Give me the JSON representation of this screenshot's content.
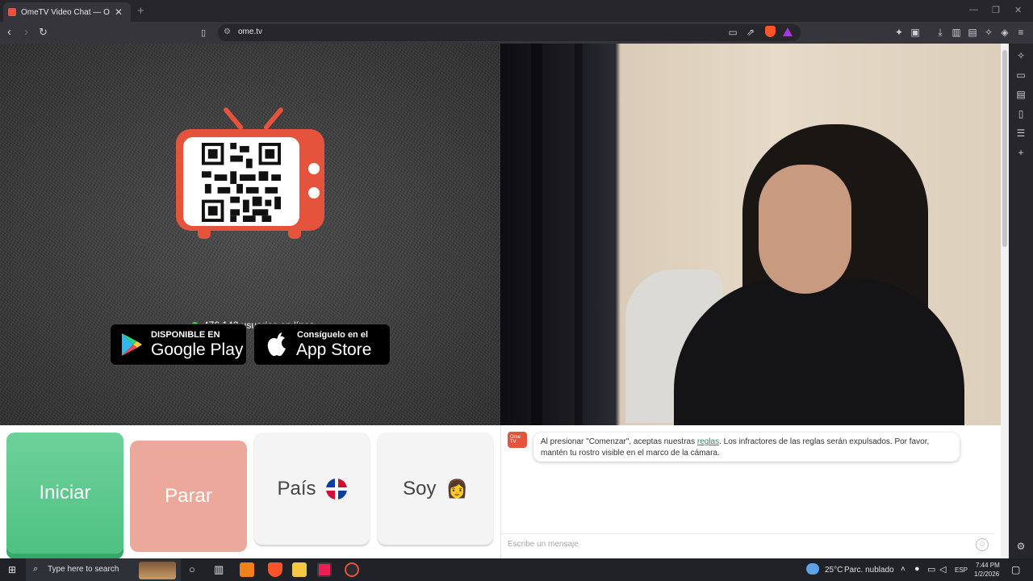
{
  "browser": {
    "tab_title": "OmeTV Video Chat — Omeg",
    "tab_close": "✕",
    "new_tab": "+",
    "url": "ome.tv",
    "window_controls": {
      "minimize": "—",
      "restore": "❐",
      "close": "✕"
    }
  },
  "page": {
    "online_count": "476.142 usuarios en línea",
    "google_play": {
      "small": "DISPONIBLE EN",
      "big": "Google Play"
    },
    "app_store": {
      "small": "Consíguelo en el",
      "big": "App Store"
    },
    "buttons": {
      "start": "Iniciar",
      "stop": "Parar",
      "country": "País",
      "gender": "Soy"
    },
    "gender_emoji": "👩",
    "chat": {
      "logo": "Ome TV",
      "notice_before": "Al presionar \"Comenzar\", aceptas nuestras ",
      "notice_link": "reglas",
      "notice_after": ". Los infractores de las reglas serán expulsados. Por favor, mantén tu rostro visible en el marco de la cámara.",
      "placeholder": "Escribe un mensaje"
    }
  },
  "taskbar": {
    "search_placeholder": "Type here to search",
    "temperature": "25°C",
    "weather": "Parc. nublado",
    "language": "ESP",
    "time": "7:44 PM",
    "date": "1/2/2026"
  },
  "icons": {
    "back": "back-icon",
    "forward": "forward-icon",
    "reload": "reload-icon",
    "bookmark": "bookmark-icon",
    "brave": "brave-shield-icon",
    "rewards": "brave-rewards-icon"
  }
}
